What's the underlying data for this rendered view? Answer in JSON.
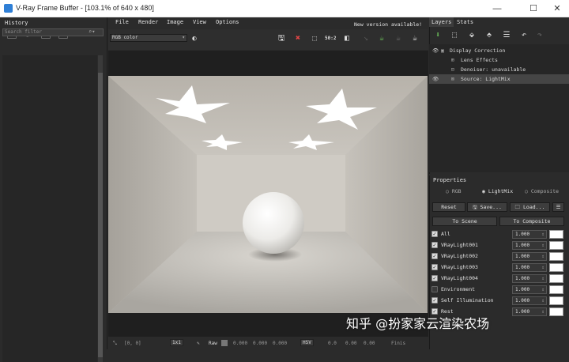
{
  "window": {
    "title": "V-Ray Frame Buffer - [103.1% of 640 x 480]",
    "controls": {
      "minimize": "—",
      "maximize": "☐",
      "close": "✕"
    }
  },
  "history": {
    "header": "History",
    "search_placeholder": "Search filter"
  },
  "menu": {
    "items": [
      "File",
      "Render",
      "Image",
      "View",
      "Options"
    ],
    "notice": "New version available!"
  },
  "toolbar": {
    "channel": "RGB color",
    "zoom_label": "50:2"
  },
  "status": {
    "coords": "[0, 0]",
    "ratio": "1x1",
    "raw_label": "Raw",
    "raw_values": [
      "0.000",
      "0.000",
      "0.000"
    ],
    "color_space": "HSV",
    "hsv_values": [
      "0.0",
      "0.00",
      "0.00"
    ],
    "finished": "Finis"
  },
  "layers": {
    "tabs": [
      "Layers",
      "Stats"
    ],
    "tree": [
      {
        "label": "Display Correction",
        "eye": true,
        "selected": false,
        "indent": 0
      },
      {
        "label": "Lens Effects",
        "eye": false,
        "selected": false,
        "indent": 1
      },
      {
        "label": "Denoiser: unavailable",
        "eye": false,
        "selected": false,
        "indent": 1
      },
      {
        "label": "Source: LightMix",
        "eye": true,
        "selected": true,
        "indent": 1
      }
    ]
  },
  "properties": {
    "header": "Properties",
    "modes": [
      "RGB",
      "LightMix",
      "Composite"
    ],
    "active_mode": "LightMix",
    "buttons": {
      "reset": "Reset",
      "save": "Save...",
      "load": "Load...",
      "to_scene": "To Scene",
      "to_composite": "To Composite"
    },
    "lights": [
      {
        "name": "All",
        "checked": true,
        "value": "1.000"
      },
      {
        "name": "VRayLight001",
        "checked": true,
        "value": "1.000"
      },
      {
        "name": "VRayLight002",
        "checked": true,
        "value": "1.000"
      },
      {
        "name": "VRayLight003",
        "checked": true,
        "value": "1.000"
      },
      {
        "name": "VRayLight004",
        "checked": true,
        "value": "1.000"
      },
      {
        "name": "Environment",
        "checked": false,
        "value": "1.000"
      },
      {
        "name": "Self Illumination",
        "checked": true,
        "value": "1.000"
      },
      {
        "name": "Rest",
        "checked": true,
        "value": "1.000"
      }
    ]
  },
  "watermark": "知乎 @扮家家云渲染农场",
  "colors": {
    "accent": "#2f7fd6",
    "panel": "#2b2b2b",
    "render_wall": "#cfcac2"
  }
}
